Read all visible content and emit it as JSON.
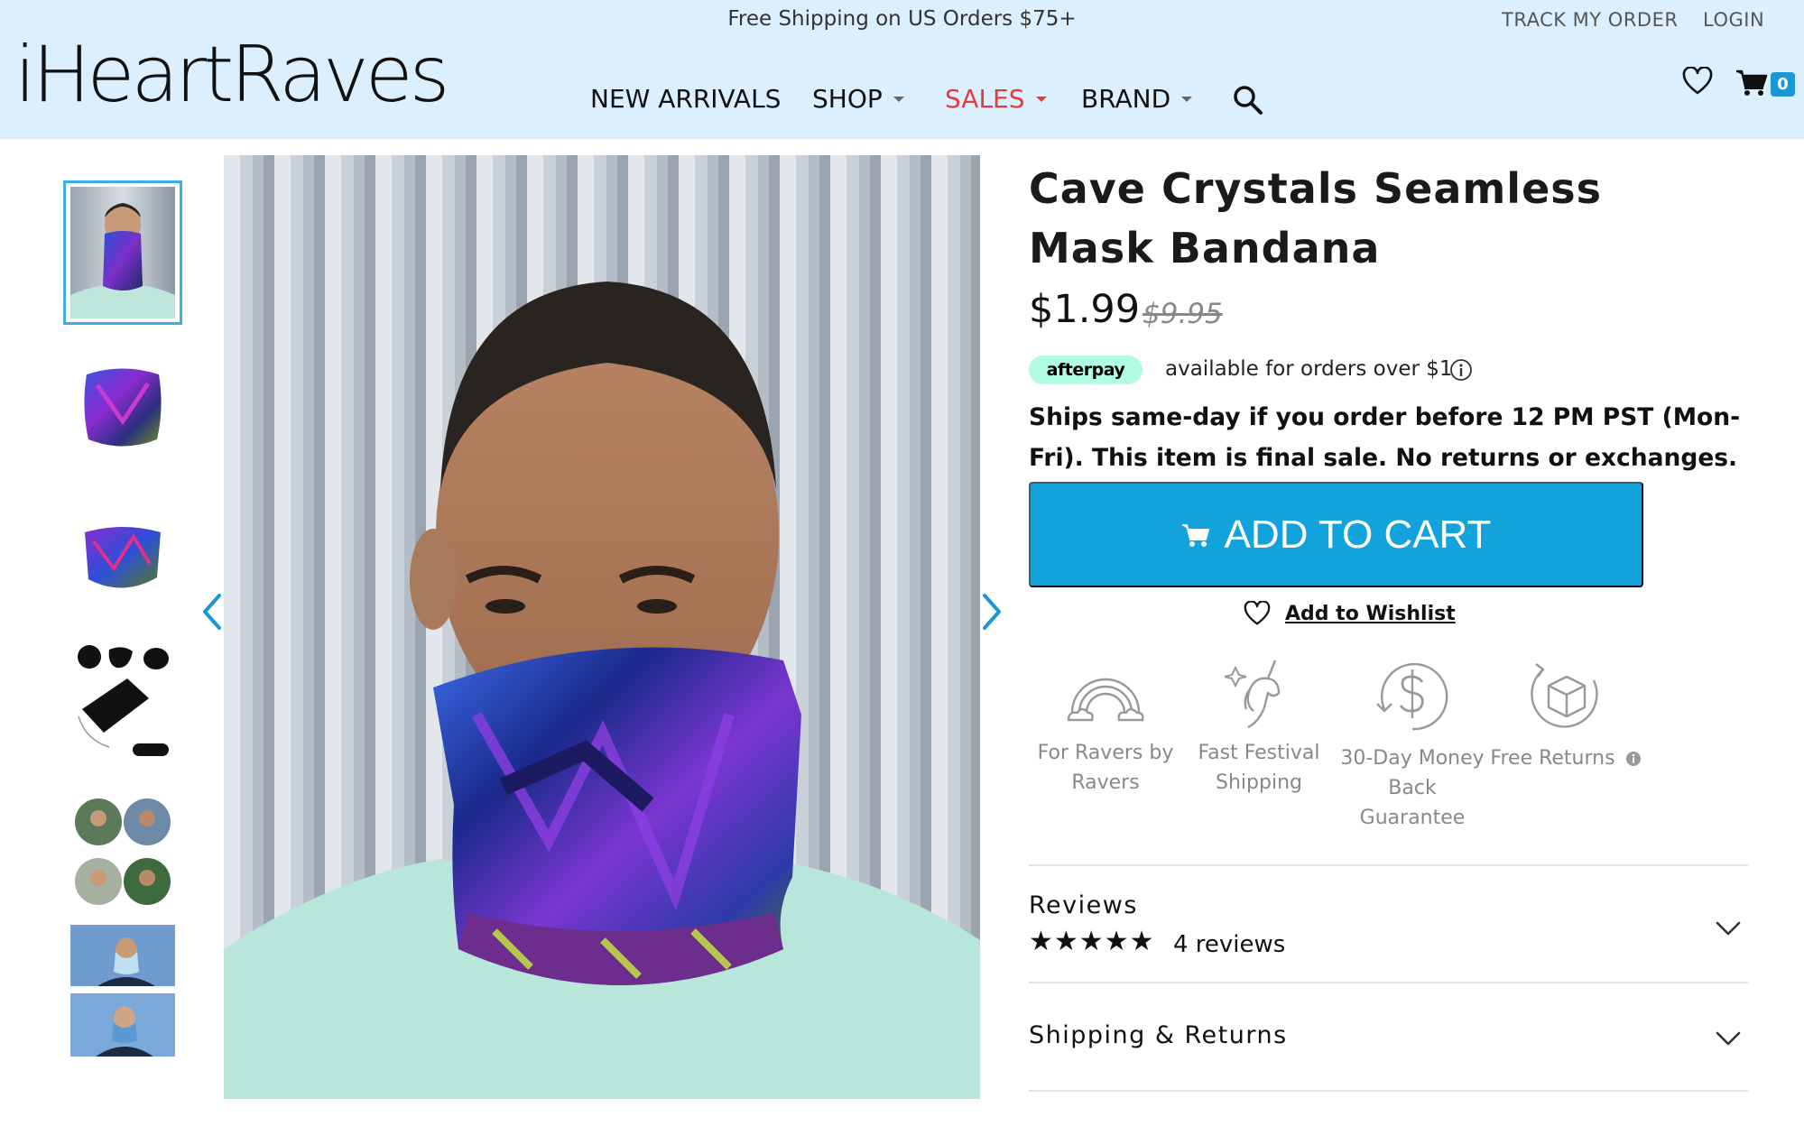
{
  "header": {
    "promo": "Free Shipping on US Orders $75+",
    "track_order": "TRACK MY ORDER",
    "login": "LOGIN",
    "logo": "iHeartRaves",
    "nav": {
      "new_arrivals": "NEW ARRIVALS",
      "shop": "SHOP",
      "sales": "SALES",
      "brand": "BRAND"
    },
    "cart_count": "0",
    "colors": {
      "background": "#dcefff",
      "sales": "#e83a3a",
      "badge": "#1a98d5"
    }
  },
  "gallery": {
    "thumbnails": [
      "model-front",
      "bandana-flat",
      "bandana-folded",
      "mask-accessories",
      "wear-styles-grid",
      "models-wearing"
    ],
    "active_index": 0
  },
  "product": {
    "title": "Cave Crystals Seamless Mask Bandana",
    "price": "$1.99",
    "compare_price": "$9.95",
    "afterpay_logo": "afterpay",
    "afterpay_text": "available for orders over $1",
    "shipping_note": "Ships same-day if you order before 12 PM PST (Mon-Fri). This item is final sale. No returns or exchanges.",
    "add_to_cart": "ADD TO CART",
    "wishlist": "Add to Wishlist",
    "accent_color": "#13a3dc"
  },
  "features": [
    {
      "icon": "rainbow-icon",
      "label": "For Ravers by Ravers"
    },
    {
      "icon": "unicorn-icon",
      "label": "Fast Festival Shipping"
    },
    {
      "icon": "dollar-icon",
      "label": "30-Day Money Back Guarantee"
    },
    {
      "icon": "box-return-icon",
      "label": "Free Returns"
    }
  ],
  "accordion": {
    "reviews_title": "Reviews",
    "rating": "★★★★★",
    "reviews_count": "4 reviews",
    "shipping_title": "Shipping & Returns"
  }
}
